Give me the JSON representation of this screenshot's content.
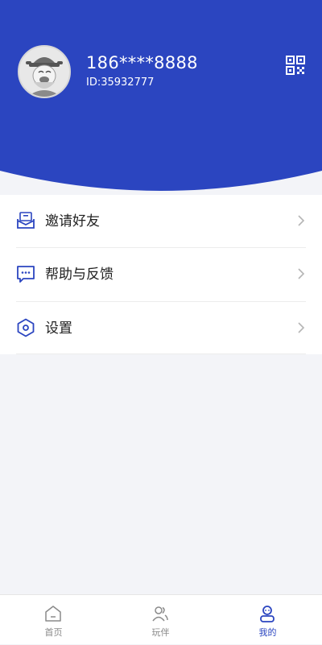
{
  "colors": {
    "brand_blue": "#2b45c0",
    "background": "#f3f4f8",
    "text_dark": "#222222",
    "tab_inactive": "#888888"
  },
  "profile": {
    "phone": "186****8888",
    "id_text": "ID:35932777",
    "avatar_icon": "user-avatar-caishen",
    "qr_icon": "qr-code-icon"
  },
  "menu": {
    "items": [
      {
        "label": "邀请好友",
        "icon": "invite-envelope-icon"
      },
      {
        "label": "帮助与反馈",
        "icon": "chat-bubble-icon"
      },
      {
        "label": "设置",
        "icon": "settings-hexagon-icon"
      }
    ]
  },
  "tabbar": {
    "tabs": [
      {
        "label": "首页",
        "icon": "home-icon",
        "active": false
      },
      {
        "label": "玩伴",
        "icon": "friends-icon",
        "active": false
      },
      {
        "label": "我的",
        "icon": "profile-icon",
        "active": true
      }
    ]
  }
}
